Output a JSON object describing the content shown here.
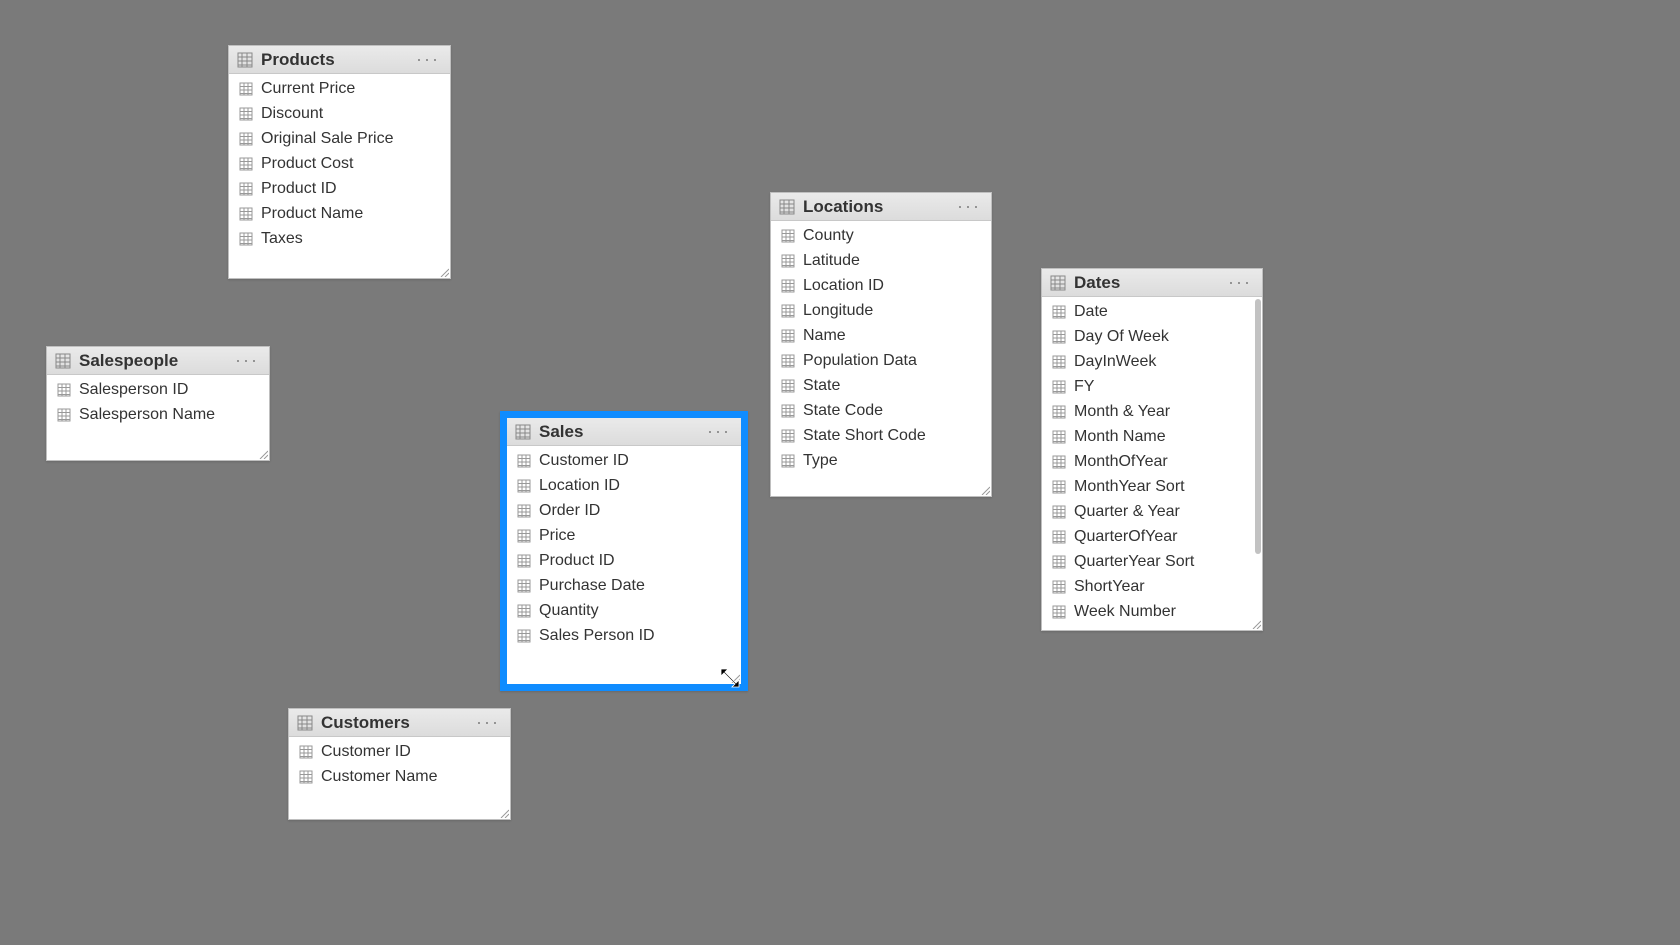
{
  "tables": {
    "products": {
      "name": "Products",
      "fields": [
        "Current Price",
        "Discount",
        "Original Sale Price",
        "Product Cost",
        "Product ID",
        "Product Name",
        "Taxes"
      ]
    },
    "salespeople": {
      "name": "Salespeople",
      "fields": [
        "Salesperson ID",
        "Salesperson Name"
      ]
    },
    "sales": {
      "name": "Sales",
      "fields": [
        "Customer ID",
        "Location ID",
        "Order ID",
        "Price",
        "Product ID",
        "Purchase Date",
        "Quantity",
        "Sales Person ID"
      ]
    },
    "customers": {
      "name": "Customers",
      "fields": [
        "Customer ID",
        "Customer Name"
      ]
    },
    "locations": {
      "name": "Locations",
      "fields": [
        "County",
        "Latitude",
        "Location ID",
        "Longitude",
        "Name",
        "Population Data",
        "State",
        "State Code",
        "State Short Code",
        "Type"
      ]
    },
    "dates": {
      "name": "Dates",
      "fields": [
        "Date",
        "Day Of Week",
        "DayInWeek",
        "FY",
        "Month & Year",
        "Month Name",
        "MonthOfYear",
        "MonthYear Sort",
        "Quarter & Year",
        "QuarterOfYear",
        "QuarterYear Sort",
        "ShortYear",
        "Week Number"
      ]
    }
  },
  "ui": {
    "more_label": "···"
  }
}
